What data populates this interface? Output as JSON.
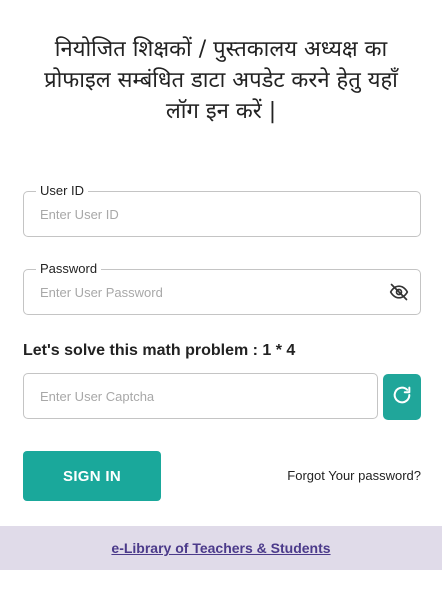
{
  "heading": {
    "line1": "नियोजित शिक्षकों / पुस्तकालय अध्यक्ष का",
    "line2": "प्रोफाइल सम्बंधित डाटा अपडेट करने हेतु यहाँ",
    "line3": "लॉग इन करें |"
  },
  "user_id": {
    "label": "User ID",
    "placeholder": "Enter User ID",
    "value": ""
  },
  "password": {
    "label": "Password",
    "placeholder": "Enter User Password",
    "value": "",
    "toggle_icon": "eye-off-icon"
  },
  "captcha": {
    "prompt": "Let's solve this math problem : 1 * 4",
    "placeholder": "Enter User Captcha",
    "value": "",
    "refresh_icon": "refresh-icon"
  },
  "actions": {
    "signin_label": "SIGN IN",
    "forgot_label": "Forgot Your password?"
  },
  "footer": {
    "link_label": "e-Library of Teachers & Students"
  },
  "colors": {
    "accent": "#1aa89b",
    "footer_bg": "#e0dbe9",
    "footer_link": "#4b3a8a"
  }
}
